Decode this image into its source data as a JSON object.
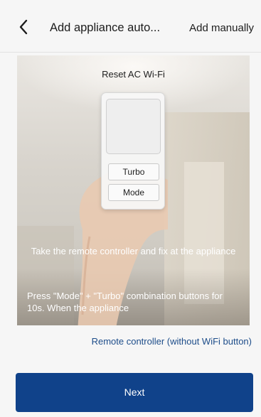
{
  "header": {
    "title": "Add appliance auto...",
    "add_manually": "Add manually"
  },
  "panel": {
    "title": "Reset AC Wi-Fi",
    "remote_buttons": [
      "Turbo",
      "Mode"
    ],
    "instruction_1": "Take the remote controller and fix at the appliance",
    "instruction_2": "Press \"Mode\" + \"Turbo\" combination buttons for 10s. When the appliance"
  },
  "remote_link": "Remote controller (without WiFi button)",
  "next_label": "Next",
  "colors": {
    "primary": "#10428a",
    "link": "#1d4d8a",
    "background": "#f6f6f6"
  },
  "icons": {
    "back": "chevron-left-icon"
  }
}
